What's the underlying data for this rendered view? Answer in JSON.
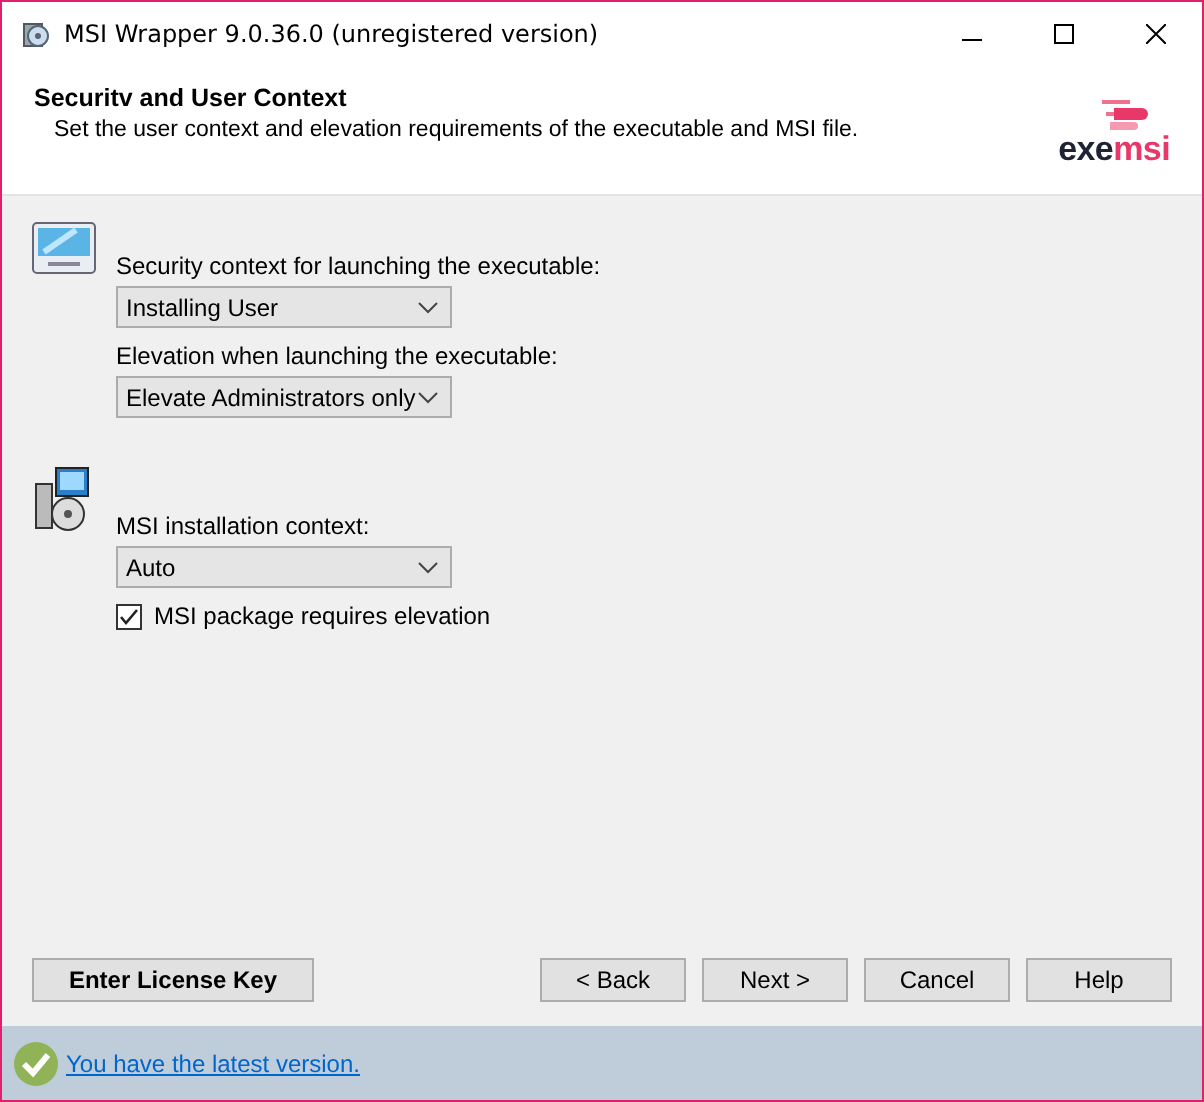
{
  "window": {
    "title": "MSI Wrapper 9.0.36.0 (unregistered version)"
  },
  "header": {
    "title": "Securitv and User Context",
    "subtitle": "Set the user context and elevation requirements of the executable and MSI file.",
    "logo": [
      "exe",
      "msi"
    ]
  },
  "sections": [
    {
      "kind": "executable",
      "fields": [
        {
          "kind": "dropdown",
          "label": "Security context for launching the executable:",
          "value": "Installing User"
        },
        {
          "kind": "dropdown",
          "label": "Elevation when launching the executable:",
          "value": "Elevate Administrators only"
        }
      ]
    },
    {
      "kind": "msi",
      "fields": [
        {
          "kind": "dropdown",
          "label": "MSI installation context:",
          "value": "Auto"
        },
        {
          "kind": "checkbox",
          "label": "MSI package requires elevation",
          "checked": true
        }
      ]
    }
  ],
  "license_button": "Enter License Key",
  "buttons": [
    "< Back",
    "Next >",
    "Cancel",
    "Help"
  ],
  "status_bar": {
    "link": "You have the latest version."
  }
}
